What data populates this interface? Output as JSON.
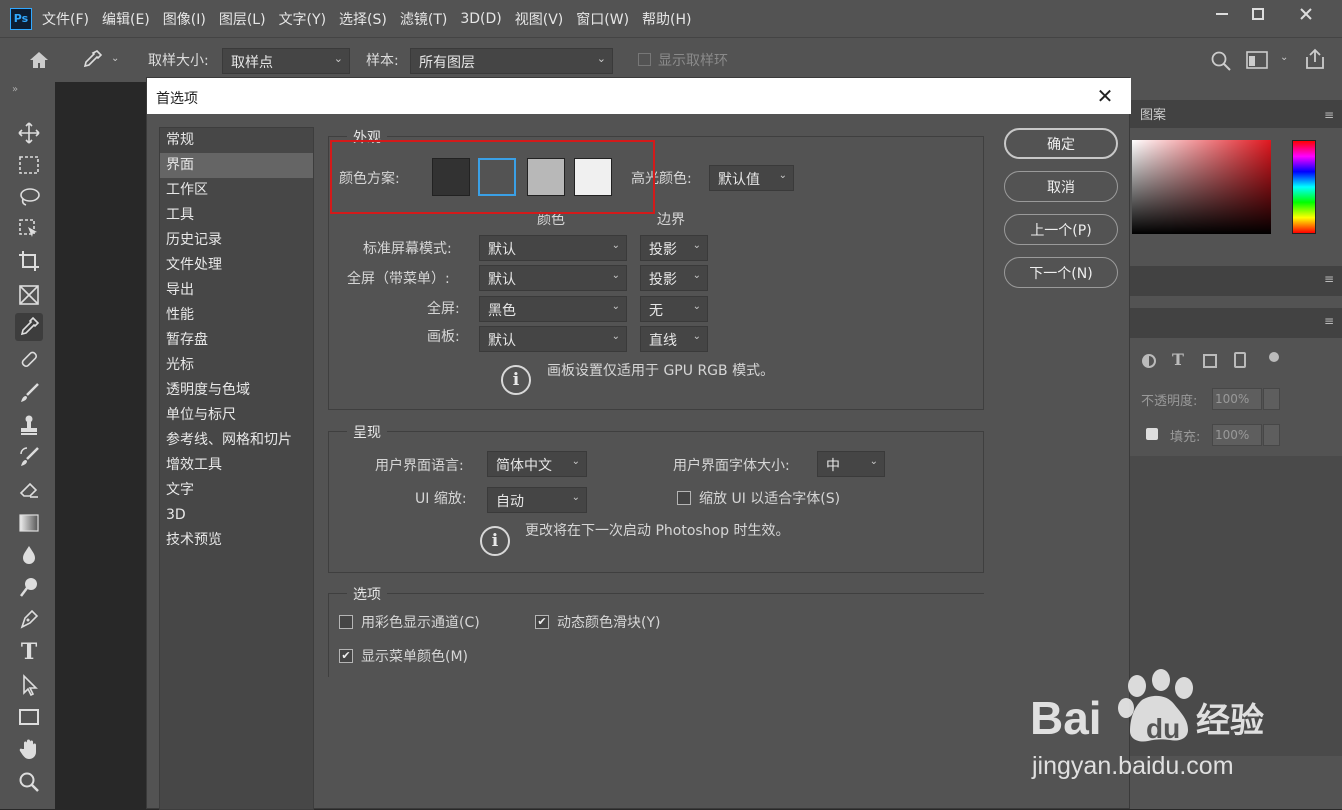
{
  "app": {
    "logo": "Ps"
  },
  "menubar": {
    "items": [
      "文件(F)",
      "编辑(E)",
      "图像(I)",
      "图层(L)",
      "文字(Y)",
      "选择(S)",
      "滤镜(T)",
      "3D(D)",
      "视图(V)",
      "窗口(W)",
      "帮助(H)"
    ]
  },
  "window_controls": {
    "minimize": "minimize-icon",
    "maximize": "maximize-icon",
    "close": "close-icon"
  },
  "options_bar": {
    "sample_size_label": "取样大小:",
    "sample_size_value": "取样点",
    "sample_label": "样本:",
    "sample_value": "所有图层",
    "show_ring_label": "显示取样环"
  },
  "right_panel": {
    "tab_pattern": "图案",
    "opacity_label": "不透明度:",
    "opacity_value": "100%",
    "fill_label": "填充:",
    "fill_value": "100%"
  },
  "dialog": {
    "title": "首选项",
    "nav": [
      "常规",
      "界面",
      "工作区",
      "工具",
      "历史记录",
      "文件处理",
      "导出",
      "性能",
      "暂存盘",
      "光标",
      "透明度与色域",
      "单位与标尺",
      "参考线、网格和切片",
      "增效工具",
      "文字",
      "3D",
      "技术预览"
    ],
    "selected_nav_index": 1,
    "buttons": {
      "ok": "确定",
      "cancel": "取消",
      "prev": "上一个(P)",
      "next": "下一个(N)"
    },
    "appearance": {
      "title": "外观",
      "color_theme_label": "颜色方案:",
      "swatches": [
        "#323232",
        "#535353",
        "#b8b8b8",
        "#f0f0f0"
      ],
      "selected_swatch": 1,
      "highlight_label": "高光颜色:",
      "highlight_value": "默认值",
      "col_color": "颜色",
      "col_border": "边界",
      "rows": [
        {
          "label": "标准屏幕模式:",
          "color": "默认",
          "border": "投影"
        },
        {
          "label": "全屏（带菜单）:",
          "color": "默认",
          "border": "投影"
        },
        {
          "label": "全屏:",
          "color": "黑色",
          "border": "无"
        },
        {
          "label": "画板:",
          "color": "默认",
          "border": "直线"
        }
      ],
      "note": "画板设置仅适用于 GPU RGB 模式。"
    },
    "presentation": {
      "title": "呈现",
      "lang_label": "用户界面语言:",
      "lang_value": "简体中文",
      "fontsize_label": "用户界面字体大小:",
      "fontsize_value": "中",
      "scale_label": "UI 缩放:",
      "scale_value": "自动",
      "scale_font_label": "缩放 UI 以适合字体(S)",
      "scale_font_checked": false,
      "note": "更改将在下一次启动 Photoshop 时生效。"
    },
    "options": {
      "title": "选项",
      "color_channels": {
        "label": "用彩色显示通道(C)",
        "checked": false
      },
      "dynamic_sliders": {
        "label": "动态颜色滑块(Y)",
        "checked": true
      },
      "menu_colors": {
        "label": "显示菜单颜色(M)",
        "checked": true
      }
    }
  },
  "watermark": {
    "brand": "Bai du 经验",
    "url": "jingyan.baidu.com"
  }
}
